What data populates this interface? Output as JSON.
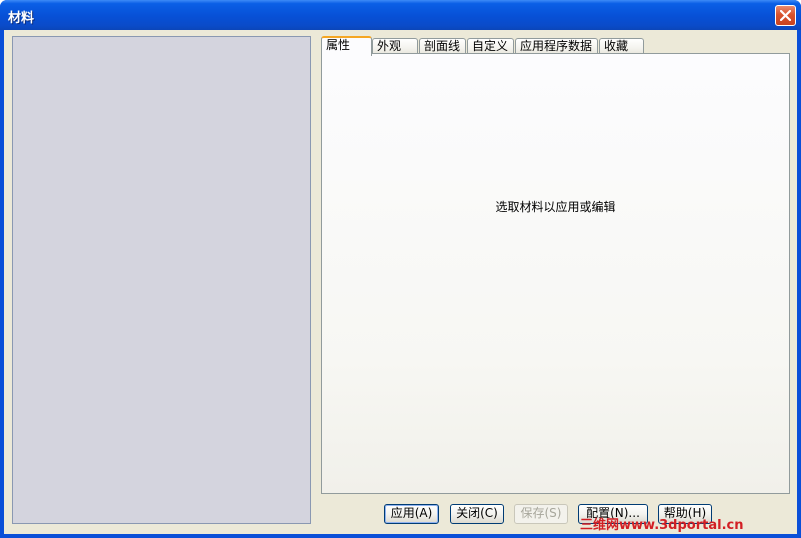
{
  "window": {
    "title": "材料"
  },
  "tabs": [
    {
      "label": "属性"
    },
    {
      "label": "外观"
    },
    {
      "label": "剖面线"
    },
    {
      "label": "自定义"
    },
    {
      "label": "应用程序数据"
    },
    {
      "label": "收藏"
    }
  ],
  "panel": {
    "message": "选取材料以应用或编辑"
  },
  "buttons": {
    "apply": "应用(A)",
    "close": "关闭(C)",
    "save": "保存(S)",
    "config": "配置(N)...",
    "help": "帮助(H)"
  },
  "watermark": {
    "text": "三维网www.3dportal.cn"
  },
  "colors": {
    "active_tab_accent": "#f5a623",
    "title_bar": "#0750d6",
    "close_button": "#d8532e"
  }
}
